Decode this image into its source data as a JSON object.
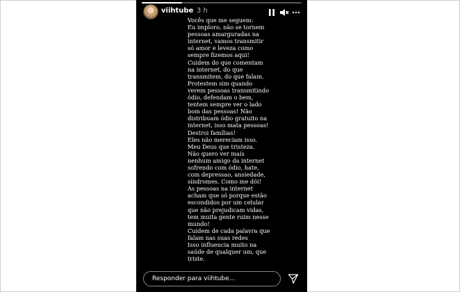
{
  "story": {
    "progress": 0.25,
    "username": "viihtube",
    "timestamp": "3 h",
    "icons": [
      "pause-icon",
      "mute-icon",
      "more-icon",
      "send-icon"
    ],
    "caption_lines": [
      "Vocês que me seguem:",
      "Eu imploro, não se tornem",
      "pessoas amarguradas na",
      "internet, vamos transmitir",
      "só amor e leveza como",
      "sempre fizemos aqui!",
      "Cuidem do que comentam",
      "na internet, do que",
      "transmitem, do que falam.",
      "Protestem sim quando",
      "verem pessoas transmitindo",
      "ódio, defendam o bem,",
      "tentem sempre ver o lado",
      "bom das pessoas! Não",
      "distribuam ódio gratuito na",
      "internet, isso mata pessoas!",
      "Destroi famílias!",
      "Eles não mereciam isso.",
      "Meu Deus que tristeza.",
      "Não quero ver mais",
      "nenhum amigo da internet",
      "sofrendo com ódio, hate,",
      "com depressao, ansiedade,",
      "síndromes. Como me dói!",
      "As pessoas na internet",
      "acham que só porque estão",
      "escondidos por um celular",
      "que não prejudicam vidas,",
      "tem muita gente ruim nesse",
      "mundo!",
      "Cuidem de cada palavra que",
      "falam nas suas redes",
      "Isso influencia muito na",
      "saúde de qualquer um, que",
      "triste."
    ],
    "reply_placeholder": "Responder para viihtube..."
  },
  "colors": {
    "story_background": "#000000",
    "text": "#ffffff",
    "page_background": "#ffffff"
  }
}
